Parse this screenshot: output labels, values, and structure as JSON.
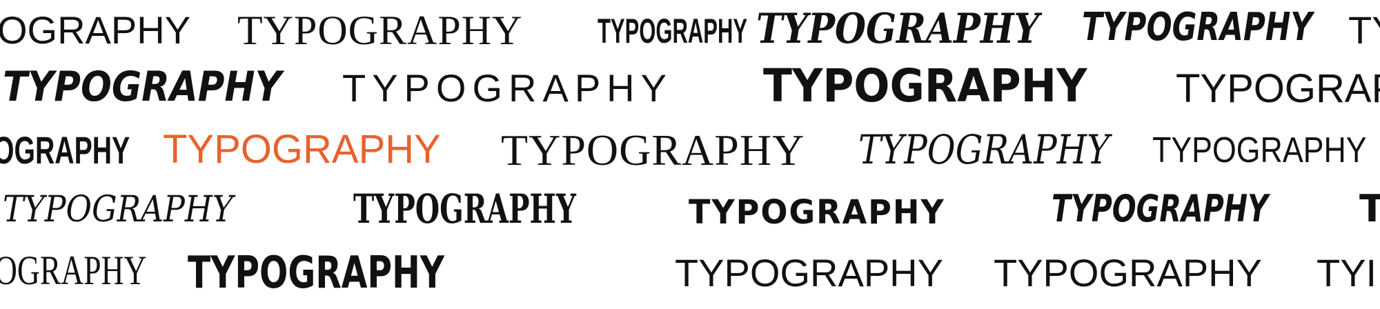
{
  "word": "TYPOGRAPHY",
  "rows": [
    {
      "words": [
        {
          "text": "OGRAPHY",
          "color": "#111111"
        },
        {
          "text": "TYPOGRAPHY",
          "color": "#111111"
        },
        {
          "text": "TYPOGRAPHY",
          "color": "#111111"
        },
        {
          "text": "TYPOGRAPHY",
          "color": "#111111"
        },
        {
          "text": "TYPOGRAPHY",
          "color": "#111111"
        },
        {
          "text": "TY",
          "color": "#111111"
        }
      ]
    },
    {
      "words": [
        {
          "text": "TYPOGRAPHY",
          "color": "#111111"
        },
        {
          "text": "TYPOGRAPHY",
          "color": "#111111"
        },
        {
          "text": "TYPOGRAPHY",
          "color": "#111111"
        },
        {
          "text": "TYPOGRAP",
          "color": "#111111"
        }
      ]
    },
    {
      "words": [
        {
          "text": "OGRAPHY",
          "color": "#111111"
        },
        {
          "text": "TYPOGRAPHY",
          "color": "#e8622c"
        },
        {
          "text": "TYPOGRAPHY",
          "color": "#111111"
        },
        {
          "text": "TYPOGRAPHY",
          "color": "#111111"
        },
        {
          "text": "TYPOGRAPHY",
          "color": "#111111"
        }
      ]
    },
    {
      "words": [
        {
          "text": "TYPOGRAPHY",
          "color": "#111111"
        },
        {
          "text": "TYPOGRAPHY",
          "color": "#111111"
        },
        {
          "text": "TYPOGRAPHY",
          "color": "#111111"
        },
        {
          "text": "TYPOGRAPHY",
          "color": "#111111"
        },
        {
          "text": "T",
          "color": "#111111"
        }
      ]
    },
    {
      "words": [
        {
          "text": "OGRAPHY",
          "color": "#111111"
        },
        {
          "text": "TYPOGRAPHY",
          "color": "#111111"
        },
        {
          "text": "TYPOGRAPHY",
          "color": "#111111"
        },
        {
          "text": "TYPOGRAPHY",
          "color": "#111111"
        },
        {
          "text": "TYI",
          "color": "#111111"
        }
      ]
    }
  ]
}
